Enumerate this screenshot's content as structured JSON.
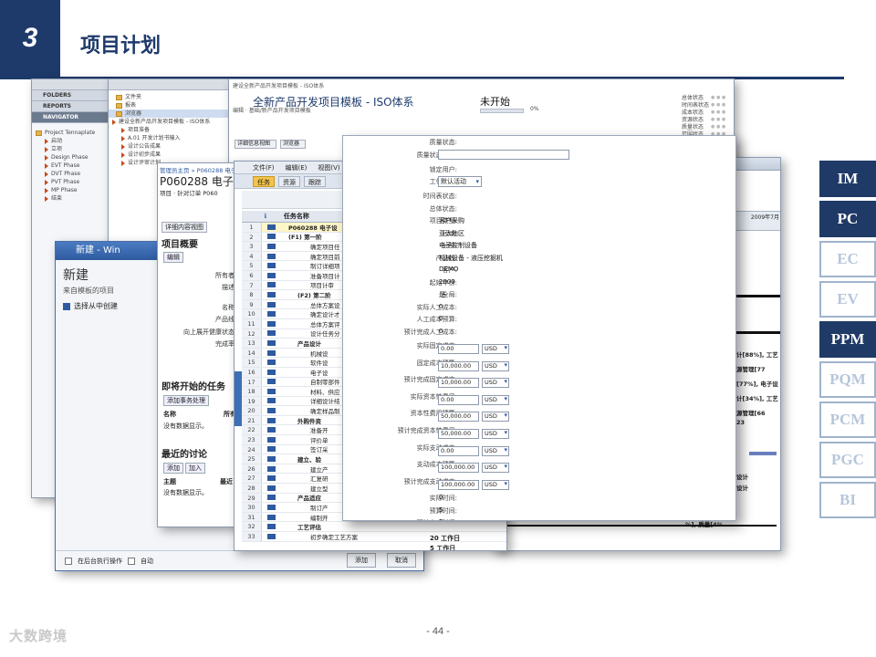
{
  "slide": {
    "number": "3",
    "title": "项目计划",
    "page": "- 44 -",
    "watermark": "大数跨境"
  },
  "side_nav": [
    {
      "label": "IM",
      "active": true
    },
    {
      "label": "PC",
      "active": true
    },
    {
      "label": "EC",
      "active": false
    },
    {
      "label": "EV",
      "active": false
    },
    {
      "label": "PPM",
      "active": true
    },
    {
      "label": "PQM",
      "active": false
    },
    {
      "label": "PCM",
      "active": false
    },
    {
      "label": "PGC",
      "active": false
    },
    {
      "label": "BI",
      "active": false
    }
  ],
  "navigator": {
    "bars": [
      "FOLDERS",
      "REPORTS",
      "NAVIGATOR"
    ],
    "tree": [
      "Project Tennaplate",
      "启动",
      "立项",
      "Design Phase",
      "EVT Phase",
      "DVT Phase",
      "PVT Phase",
      "MP Phase",
      "结束"
    ]
  },
  "folder_tree": {
    "items": [
      "文件夹",
      "报表",
      "浏览器",
      "建设全新产品开发项目模板 - ISO体系",
      "项目准备",
      "A.01 开发计划书输入",
      "设计公告成果",
      "设计初步成果",
      "设计评审计划"
    ]
  },
  "template": {
    "crumbs": "建设全新产品开发项目模板 - ISO体系",
    "crumbs2": "编辑 · 基础/新产品开发项目模板",
    "title": "全新产品开发项目模板 - ISO体系",
    "status": "未开始",
    "progress_label": "0%",
    "progress": 0,
    "right_labels": [
      "总体状态",
      "时间表状态",
      "成本状态",
      "资源状态",
      "质量状态",
      "范围状态"
    ]
  },
  "new_dialog": {
    "title": "新建 - Win",
    "heading": "新建",
    "sub": "来自模板的项目",
    "option": "选择从中创建",
    "checkbox1": "在后台执行操作",
    "checkbox2": "自动",
    "ok": "添加",
    "cancel": "取消"
  },
  "project_detail": {
    "crumb": "管理员主页 » P060288 电子",
    "id": "P060288 电子拆",
    "sub": "项目 · 针对订单 P060",
    "tab": "详细内容视图",
    "section1": "项目概要",
    "edit": "编辑",
    "labels": [
      "所有者",
      "描述",
      "名称",
      "产品线",
      "向上展开健康状态",
      "完成率"
    ],
    "section2": "即将开始的任务",
    "add_task": "添加事务处理",
    "col_name": "名称",
    "col_owner": "所有",
    "empty1": "没有数据显示。",
    "section3": "最近的讨论",
    "add": "添加",
    "join": "加入",
    "col_topic": "主题",
    "col_recent": "最近",
    "empty2": "没有数据显示。"
  },
  "task_list": {
    "menu": [
      "文件(F)",
      "编辑(E)",
      "视图(V)"
    ],
    "tools": [
      "任务",
      "资源",
      "跟踪"
    ],
    "col_task": "任务名称",
    "rows": [
      {
        "n": "1",
        "t": "P060288 电子设",
        "bold": true
      },
      {
        "n": "2",
        "t": "(F1) 第一阶",
        "bold": true
      },
      {
        "n": "3",
        "t": "确定项目任",
        "bold": false
      },
      {
        "n": "4",
        "t": "确定项目前",
        "bold": false
      },
      {
        "n": "5",
        "t": "制订详细项",
        "bold": false
      },
      {
        "n": "6",
        "t": "准备项目计",
        "bold": false
      },
      {
        "n": "7",
        "t": "项目计审",
        "bold": false
      },
      {
        "n": "8",
        "t": "(F2) 第二阶",
        "bold": true
      },
      {
        "n": "9",
        "t": "总体方案设",
        "bold": false
      },
      {
        "n": "10",
        "t": "确定设计才",
        "bold": false
      },
      {
        "n": "11",
        "t": "总体方案评",
        "bold": false
      },
      {
        "n": "12",
        "t": "设计任务分",
        "bold": false
      },
      {
        "n": "13",
        "t": "产品设计",
        "bold": true
      },
      {
        "n": "14",
        "t": "机械设",
        "bold": false
      },
      {
        "n": "15",
        "t": "软件设",
        "bold": false
      },
      {
        "n": "16",
        "t": "电子设",
        "bold": false
      },
      {
        "n": "17",
        "t": "自制零部件",
        "bold": false
      },
      {
        "n": "18",
        "t": "材料、供应",
        "bold": false
      },
      {
        "n": "19",
        "t": "详细设计结",
        "bold": false
      },
      {
        "n": "20",
        "t": "确定样品制",
        "bold": false
      },
      {
        "n": "21",
        "t": "外购件资",
        "bold": true
      },
      {
        "n": "22",
        "t": "准备开",
        "bold": false
      },
      {
        "n": "23",
        "t": "评价单",
        "bold": false
      },
      {
        "n": "24",
        "t": "签订采",
        "bold": false
      },
      {
        "n": "25",
        "t": "建立、验",
        "bold": true
      },
      {
        "n": "26",
        "t": "建立产",
        "bold": false
      },
      {
        "n": "27",
        "t": "汇复研",
        "bold": false
      },
      {
        "n": "28",
        "t": "建立型",
        "bold": false
      },
      {
        "n": "29",
        "t": "产品适应",
        "bold": true
      },
      {
        "n": "30",
        "t": "制订产",
        "bold": false
      },
      {
        "n": "31",
        "t": "编制开",
        "bold": false
      },
      {
        "n": "32",
        "t": "工艺评估",
        "bold": true
      },
      {
        "n": "33",
        "t": "初步确定工艺方案",
        "bold": false
      }
    ],
    "dur1": "20 工作日",
    "dur2": "5 工作日"
  },
  "gantt": {
    "month": "2009年7月",
    "labels": [
      "计[88%], 工艺",
      "源管理[77",
      "[77%], 电子设",
      "计[34%], 工艺",
      "源管理[66",
      "23",
      "设计",
      "设计",
      "%], 质量[4%"
    ]
  },
  "property_form": {
    "fields": [
      {
        "label": "质量状态:",
        "value": ""
      },
      {
        "label": "质量状态原因:",
        "value": ""
      },
      {
        "label": "锁定用户:",
        "value": ""
      },
      {
        "label": "工作流程:",
        "value": "默认活动"
      },
      {
        "label": "时间表状态:",
        "value": ""
      },
      {
        "label": "总体状态:",
        "value": ""
      },
      {
        "label": "项目类型:",
        "value": "客户采购"
      },
      {
        "label": "区域:",
        "value": "亚太地区"
      },
      {
        "label": "分部:",
        "value": "电子控制设备"
      },
      {
        "label": "产品线:",
        "value": "机械设备 - 液压挖掘机"
      },
      {
        "label": "客户:",
        "value": "DEMO"
      },
      {
        "label": "起始年份:",
        "value": "2009"
      },
      {
        "label": "全局:",
        "value": "是"
      },
      {
        "label": "实际人工成本:",
        "value": "0"
      },
      {
        "label": "人工成本预算:",
        "value": "0"
      },
      {
        "label": "预计完成人工成本:",
        "value": "0"
      }
    ],
    "money": [
      {
        "label": "实际固定成本:",
        "value": "0.00",
        "cur": "USD"
      },
      {
        "label": "固定成本预算:",
        "value": "10,000.00",
        "cur": "USD"
      },
      {
        "label": "预计完成固定成本:",
        "value": "10,000.00",
        "cur": "USD"
      },
      {
        "label": "实际资本性费用:",
        "value": "0.00",
        "cur": "USD"
      },
      {
        "label": "资本性费用预算:",
        "value": "50,000.00",
        "cur": "USD"
      },
      {
        "label": "预计完成资本性费用:",
        "value": "50,000.00",
        "cur": "USD"
      },
      {
        "label": "实际支动成本:",
        "value": "0.00",
        "cur": "USD"
      },
      {
        "label": "支动成本预算:",
        "value": "100,000.00",
        "cur": "USD"
      },
      {
        "label": "预计完成支动成本:",
        "value": "100,000.00",
        "cur": "USD"
      }
    ],
    "tail": [
      {
        "label": "实际时间:",
        "value": "0"
      },
      {
        "label": "预算时间:",
        "value": "5"
      },
      {
        "label": "预计完成时间:",
        "value": "0"
      }
    ]
  }
}
